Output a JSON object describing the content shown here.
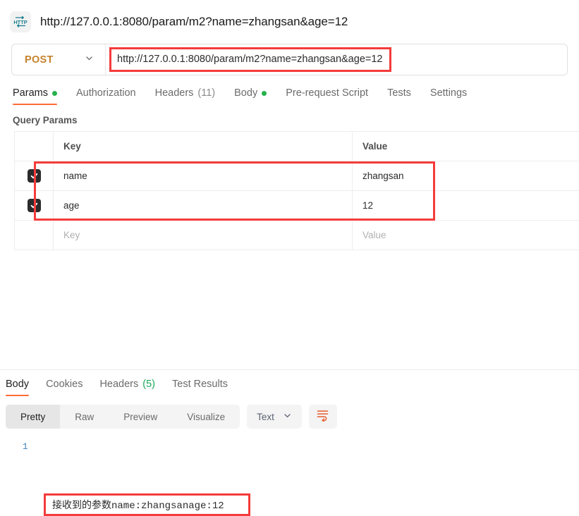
{
  "header": {
    "icon": "http-protocol-icon",
    "icon_text": "HTTP",
    "request_title": "http://127.0.0.1:8080/param/m2?name=zhangsan&age=12"
  },
  "url_bar": {
    "method": "POST",
    "method_chevron": "chevron-down-icon",
    "url": "http://127.0.0.1:8080/param/m2?name=zhangsan&age=12"
  },
  "request_tabs": [
    {
      "label": "Params",
      "dot": true,
      "count": "",
      "active": true
    },
    {
      "label": "Authorization",
      "dot": false,
      "count": "",
      "active": false
    },
    {
      "label": "Headers",
      "dot": false,
      "count": "(11)",
      "active": false
    },
    {
      "label": "Body",
      "dot": true,
      "count": "",
      "active": false
    },
    {
      "label": "Pre-request Script",
      "dot": false,
      "count": "",
      "active": false
    },
    {
      "label": "Tests",
      "dot": false,
      "count": "",
      "active": false
    },
    {
      "label": "Settings",
      "dot": false,
      "count": "",
      "active": false
    }
  ],
  "query_params": {
    "section_label": "Query Params",
    "columns": {
      "key": "Key",
      "value": "Value"
    },
    "rows": [
      {
        "checked": true,
        "key": "name",
        "value": "zhangsan"
      },
      {
        "checked": true,
        "key": "age",
        "value": "12"
      }
    ],
    "empty_row": {
      "key_placeholder": "Key",
      "value_placeholder": "Value"
    }
  },
  "response_tabs": [
    {
      "label": "Body",
      "count": "",
      "active": true
    },
    {
      "label": "Cookies",
      "count": "",
      "active": false
    },
    {
      "label": "Headers",
      "count": "(5)",
      "active": false
    },
    {
      "label": "Test Results",
      "count": "",
      "active": false
    }
  ],
  "response_toolbar": {
    "views": [
      {
        "label": "Pretty",
        "active": true
      },
      {
        "label": "Raw",
        "active": false
      },
      {
        "label": "Preview",
        "active": false
      },
      {
        "label": "Visualize",
        "active": false
      }
    ],
    "format": "Text",
    "format_chevron": "chevron-down-icon",
    "wrap_icon": "wrap-lines-icon"
  },
  "response_body": {
    "line_number": "1",
    "text_cjk": "接收到的参数",
    "text_ascii": "name:zhangsanage:12",
    "full_text": "接收到的参数name:zhangsanage:12"
  },
  "colors": {
    "accent_orange": "#ff6c37",
    "method_orange": "#c5822b",
    "highlight_red": "#f53b3b",
    "dot_green": "#26b24b",
    "count_green": "#1aa75a",
    "icon_teal": "#1a7f8e"
  }
}
